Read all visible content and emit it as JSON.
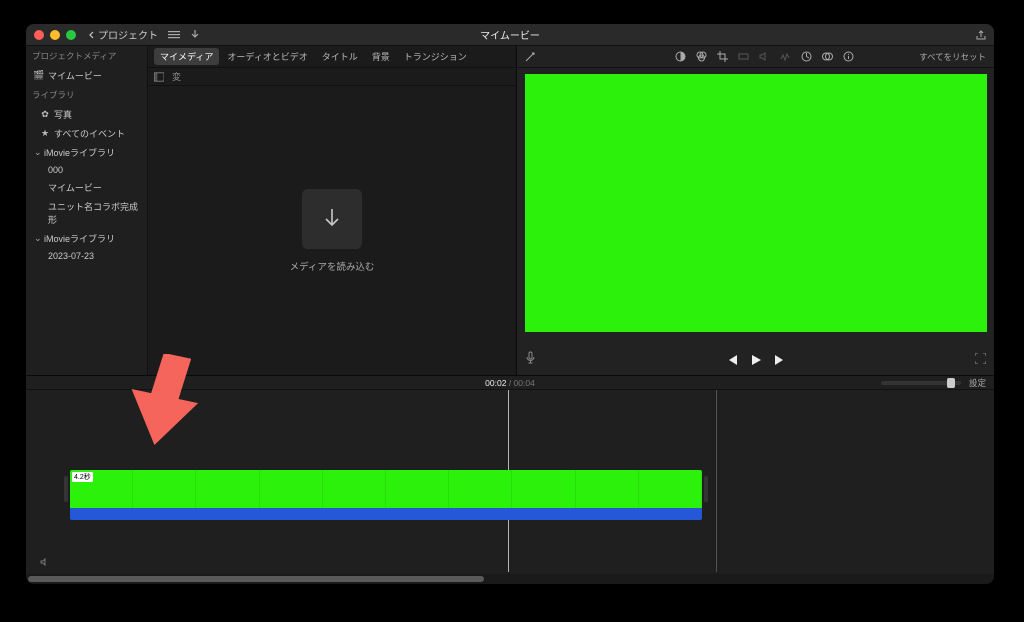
{
  "titlebar": {
    "back_label": "プロジェクト",
    "title": "マイムービー"
  },
  "sidebar": {
    "section_project": "プロジェクトメディア",
    "project_item": "マイムービー",
    "section_library": "ライブラリ",
    "photos": "写真",
    "all_events": "すべてのイベント",
    "lib1": "iMovieライブラリ",
    "lib1_items": {
      "a": "000",
      "b": "マイムービー",
      "c": "ユニット名コラボ完成形"
    },
    "lib2": "iMovieライブラリ",
    "lib2_items": {
      "a": "2023-07-23"
    }
  },
  "tabs": {
    "mymedia": "マイメディア",
    "audiovideo": "オーディオとビデオ",
    "titles": "タイトル",
    "bg": "背景",
    "transition": "トランジション"
  },
  "media_toolbar": {
    "label": "変"
  },
  "import_label": "メディアを読み込む",
  "preview": {
    "reset": "すべてをリセット"
  },
  "timeline": {
    "current": "00:02",
    "total": "00:04",
    "settings": "設定"
  },
  "clip": {
    "duration_tag": "4.2秒"
  }
}
